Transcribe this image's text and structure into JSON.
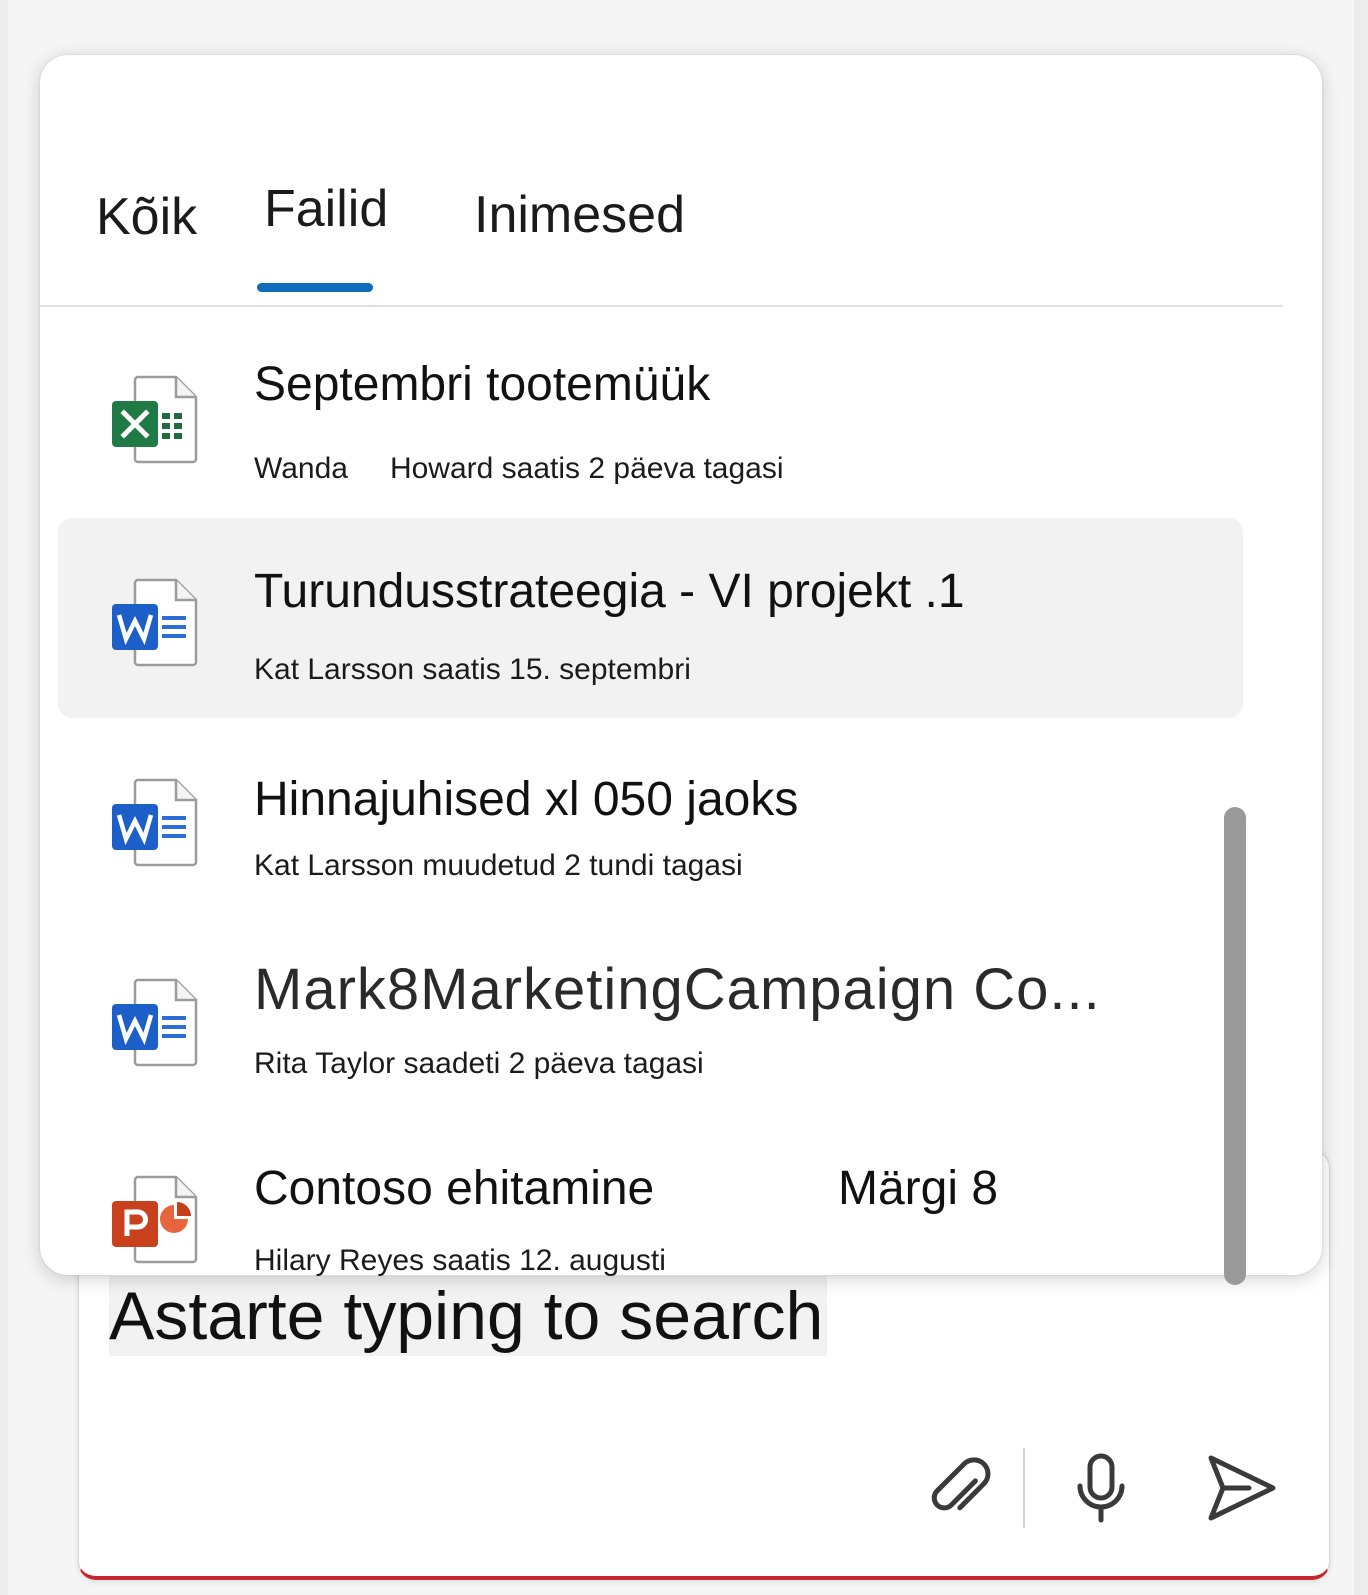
{
  "tabs": [
    {
      "label": "Kõik"
    },
    {
      "label": "Failid"
    },
    {
      "label": "Inimesed"
    }
  ],
  "active_tab": "Failid",
  "accent_color": "#0f6cbd",
  "files": [
    {
      "app": "excel",
      "icon": "excel-icon",
      "title": "Septembri tootemüük",
      "meta_sender": "Wanda",
      "meta_rest": "Howard saatis 2 päeva tagasi"
    },
    {
      "app": "word",
      "icon": "word-icon",
      "title": "Turundusstrateegia - VI projekt .1",
      "meta": "Kat Larsson saatis 15. septembri",
      "selected": true
    },
    {
      "app": "word",
      "icon": "word-icon",
      "title": "Hinnajuhised xl 050 jaoks",
      "meta": "Kat Larsson muudetud 2 tundi tagasi"
    },
    {
      "app": "word",
      "icon": "word-icon",
      "title": "Mark8MarketingCampaign Co...",
      "meta": "Rita Taylor saadeti 2 päeva tagasi"
    },
    {
      "app": "powerpoint",
      "icon": "powerpoint-icon",
      "title": "Contoso ehitamine",
      "extra": "Märgi 8",
      "meta": "Hilary Reyes saatis 12. augusti"
    }
  ],
  "compose": {
    "placeholder": "Astarte typing to search",
    "attach_icon": "paperclip-icon",
    "mic_icon": "microphone-icon",
    "send_icon": "send-icon"
  }
}
